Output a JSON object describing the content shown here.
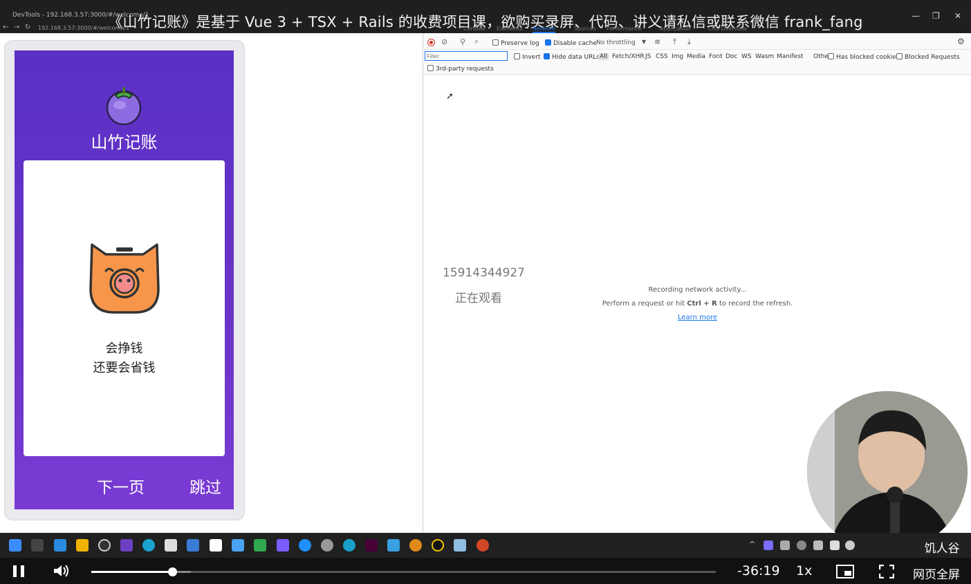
{
  "window": {
    "title": "DevTools - 192.168.3.57:3000/#/welcome/1",
    "url": "192.168.3.57:3000/#/welcome/1"
  },
  "overlay_title": "《山竹记账》是基于 Vue 3 + TSX + Rails 的收费项目课，欲购买录屏、代码、讲义请私信或联系微信 frank_fang",
  "app": {
    "title": "山竹记账",
    "card_line1": "会挣钱",
    "card_line2": "还要会省钱",
    "next_label": "下一页",
    "skip_label": "跳过"
  },
  "devtools": {
    "tabs": [
      "Console",
      "Elements",
      "Network",
      "Sources",
      "Performance",
      "Application",
      "CSS Overview"
    ],
    "active_tab": "Network",
    "preserve_log": "Preserve log",
    "disable_cache": "Disable cache",
    "throttling": "No throttling",
    "filter_placeholder": "Filter",
    "invert": "Invert",
    "hide_data_urls": "Hide data URLs",
    "types": [
      "All",
      "Fetch/XHR",
      "JS",
      "CSS",
      "Img",
      "Media",
      "Font",
      "Doc",
      "WS",
      "Wasm",
      "Manifest",
      "Other"
    ],
    "has_blocked_cookies": "Has blocked cookies",
    "blocked_requests": "Blocked Requests",
    "third_party": "3rd-party requests",
    "recording": "Recording network activity...",
    "hint_pre": "Perform a request or hit ",
    "hint_key": "Ctrl + R",
    "hint_post": " to record the refresh.",
    "learn_more": "Learn more"
  },
  "watermark": {
    "phone": "15914344927",
    "watching": "正在观看"
  },
  "webcam_label": "饥人谷",
  "video": {
    "time": "-36:19",
    "speed": "1x",
    "fullscreen_label": "网页全屏",
    "progress": 0.13,
    "buffered": 0.16
  },
  "colors": {
    "accent_purple": "#5b30c7",
    "devtools_blue": "#1a73e8",
    "record_red": "#d93025"
  }
}
